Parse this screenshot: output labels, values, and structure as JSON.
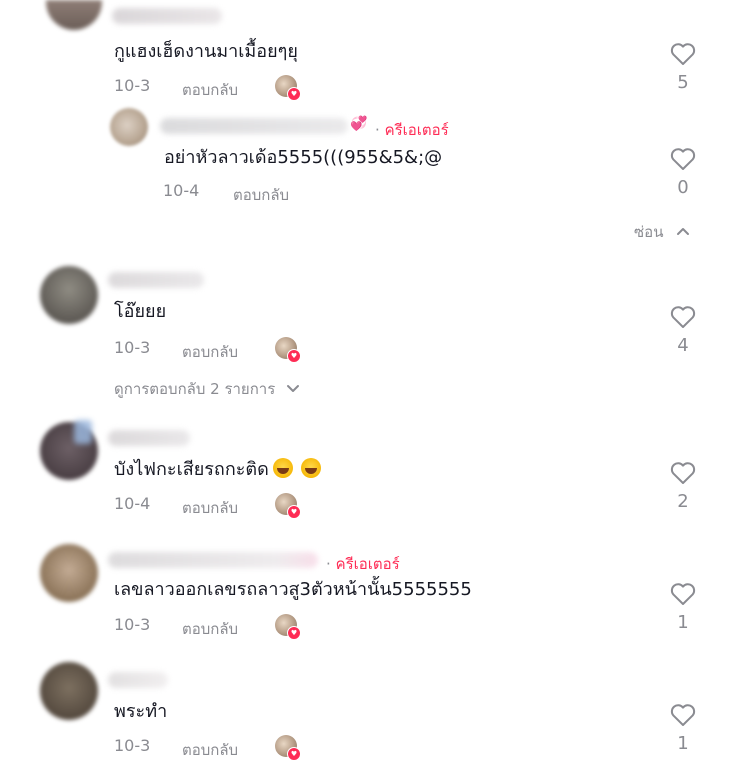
{
  "comments": [
    {
      "text": "กูแฮงเฮ็ดงานมาเมื้อยๆยุ",
      "date": "10-3",
      "reply_label": "ตอบกลับ",
      "likes": "5"
    },
    {
      "text": "อย่าหัวลาวเด้อ5555(((955&5&;@",
      "date": "10-4",
      "reply_label": "ตอบกลับ",
      "likes": "0",
      "creator_dot": "·",
      "creator_label": "ครีเอเตอร์",
      "reply_to_parent": true
    },
    {
      "text": "โอ๊ยยย",
      "date": "10-3",
      "reply_label": "ตอบกลับ",
      "likes": "4"
    },
    {
      "text": "บังไฟกะเสียรถกะติด",
      "date": "10-4",
      "reply_label": "ตอบกลับ",
      "likes": "2"
    },
    {
      "text": "เลขลาวออกเลขรถลาวสู3ตัวหน้านั้น5555555",
      "date": "10-3",
      "reply_label": "ตอบกลับ",
      "likes": "1",
      "creator_dot": "·",
      "creator_label": "ครีเอเตอร์"
    },
    {
      "text": "พระทำ",
      "date": "10-3",
      "reply_label": "ตอบกลับ",
      "likes": "1"
    }
  ],
  "hide_replies": "ซ่อน",
  "view_replies": "ดูการตอบกลับ 2 รายการ",
  "icons": {
    "like": "heart-outline-icon",
    "liked_by_creator": "heart-badge-icon",
    "hide": "chevron-up-icon",
    "view": "chevron-down-icon",
    "emoji": "laughing-emoji-icon",
    "creator_heart": "sparkling-hearts-icon"
  },
  "colors": {
    "text": "#161823",
    "muted": "#8a8b91",
    "accent": "#fe2c55"
  }
}
